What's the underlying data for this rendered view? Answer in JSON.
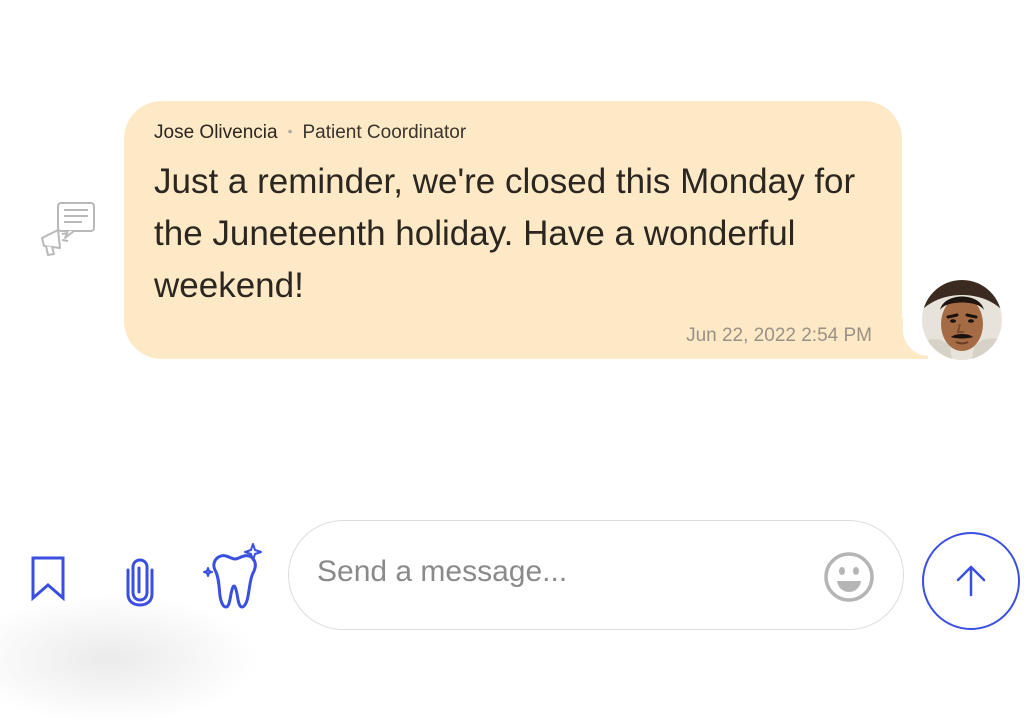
{
  "message": {
    "sender_name": "Jose Olivencia",
    "separator": "•",
    "sender_role": "Patient Coordinator",
    "text": "Just a reminder, we're closed this Monday for the Juneteenth holiday. Have a wonderful weekend!",
    "timestamp": "Jun 22, 2022 2:54 PM",
    "bubble_color": "#fde9c6",
    "type_icon": "announcement-icon"
  },
  "composer": {
    "placeholder": "Send a message...",
    "value": "",
    "emoji_icon": "smiley-icon"
  },
  "toolbar": {
    "icons": [
      "bookmark-icon",
      "paperclip-icon",
      "sparkle-tooth-icon"
    ],
    "accent_color": "#3a4fe0"
  },
  "send_button": {
    "icon": "arrow-up-icon"
  }
}
